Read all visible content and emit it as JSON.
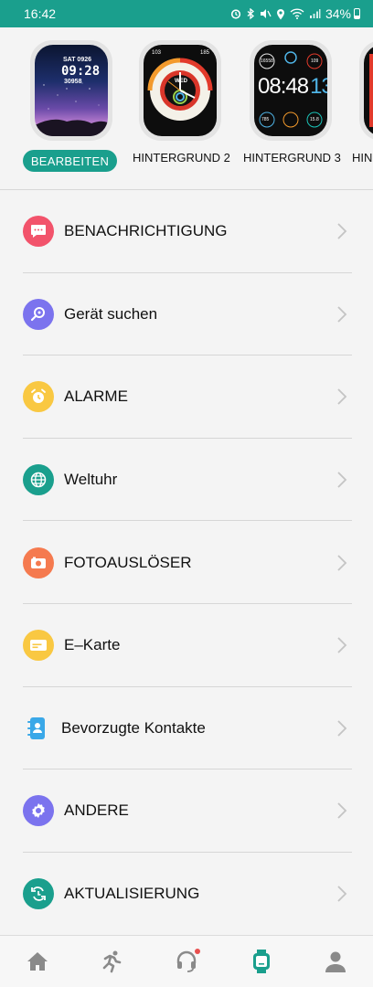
{
  "status_bar": {
    "time": "16:42",
    "battery_percent": "34%",
    "battery_level": 0.34
  },
  "watch_faces": {
    "edit_button": "BEARBEITEN",
    "face1": {
      "date": "SAT 0926",
      "time": "09:28",
      "steps": "30958"
    },
    "face2": {
      "day": "WED",
      "num_tl": "103",
      "num_tr": "185"
    },
    "face3": {
      "hour": "08",
      "minute": "48",
      "second": "13",
      "top_left": "16558",
      "top_right": "109",
      "bottom_left": "785",
      "bottom_right": "15.8"
    },
    "items": [
      {
        "label": "HINTERGRUND 2"
      },
      {
        "label": "HINTERGRUND 3"
      },
      {
        "label": "HIN"
      }
    ]
  },
  "menu": {
    "items": [
      {
        "label": "BENACHRICHTIGUNG",
        "icon": "message-icon",
        "color": "#f2536b"
      },
      {
        "label": "Gerät suchen",
        "icon": "search-device-icon",
        "color": "#7b73ee"
      },
      {
        "label": "ALARME",
        "icon": "alarm-clock-icon",
        "color": "#f9c842"
      },
      {
        "label": "Weltuhr",
        "icon": "globe-icon",
        "color": "#1a9f8d"
      },
      {
        "label": "FOTOAUSLÖSER",
        "icon": "camera-icon",
        "color": "#f57a4f"
      },
      {
        "label": "E–Karte",
        "icon": "card-icon",
        "color": "#f9c842"
      },
      {
        "label": "Bevorzugte Kontakte",
        "icon": "contacts-book-icon",
        "color": "#3aa8e8"
      },
      {
        "label": "ANDERE",
        "icon": "settings-icon",
        "color": "#7b73ee"
      },
      {
        "label": "AKTUALISIERUNG",
        "icon": "update-icon",
        "color": "#1a9f8d"
      }
    ]
  },
  "bottom_nav": {
    "items": [
      {
        "icon": "home-icon",
        "active": false
      },
      {
        "icon": "running-icon",
        "active": false
      },
      {
        "icon": "headset-icon",
        "active": false
      },
      {
        "icon": "watch-icon",
        "active": true
      },
      {
        "icon": "profile-icon",
        "active": false
      }
    ]
  },
  "colors": {
    "accent": "#1a9f8d",
    "background": "#f4f4f4"
  }
}
